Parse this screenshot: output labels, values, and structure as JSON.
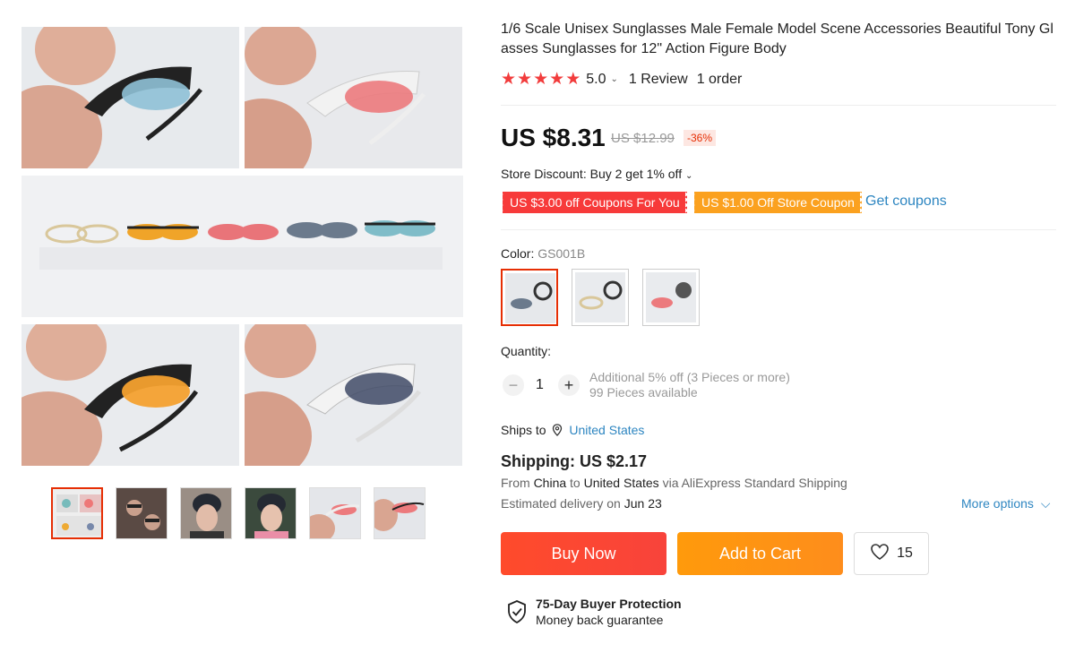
{
  "product": {
    "title": "1/6 Scale Unisex Sunglasses Male Female Model Scene Accessories Beautiful Tony Glasses Sunglasses for 12\" Action Figure Body",
    "rating": "5.0",
    "reviews": "1 Review",
    "orders": "1 order"
  },
  "price": {
    "current": "US $8.31",
    "original": "US $12.99",
    "discount": "-36%"
  },
  "store_discount": "Store Discount: Buy 2 get 1% off",
  "coupons": {
    "coupon1": "US $3.00 off Coupons For You",
    "coupon2": "US $1.00 Off Store Coupon",
    "get_link": "Get coupons"
  },
  "color": {
    "label": "Color:",
    "selected": "GS001B"
  },
  "quantity": {
    "label": "Quantity:",
    "value": "1",
    "minus": "−",
    "plus": "+",
    "bulk_note": "Additional 5% off (3 Pieces or more)",
    "available": "99 Pieces available"
  },
  "shipping": {
    "ships_to_label": "Ships to",
    "ships_to": "United States",
    "cost": "Shipping: US $2.17",
    "from_prefix": "From",
    "from_country": "China",
    "to_word": "to",
    "to_country": "United States",
    "via": "via AliExpress Standard Shipping",
    "delivery_prefix": "Estimated delivery on",
    "delivery_date": "Jun 23",
    "more_options": "More options"
  },
  "actions": {
    "buy_now": "Buy Now",
    "add_to_cart": "Add to Cart",
    "wishlist_count": "15"
  },
  "protection": {
    "title": "75-Day Buyer Protection",
    "subtitle": "Money back guarantee"
  },
  "colors": {
    "accent_red": "#e62e04",
    "star": "#f23c3c",
    "link": "#2e86c1",
    "buy": "#f8433b",
    "cart": "#fe8d1c"
  }
}
